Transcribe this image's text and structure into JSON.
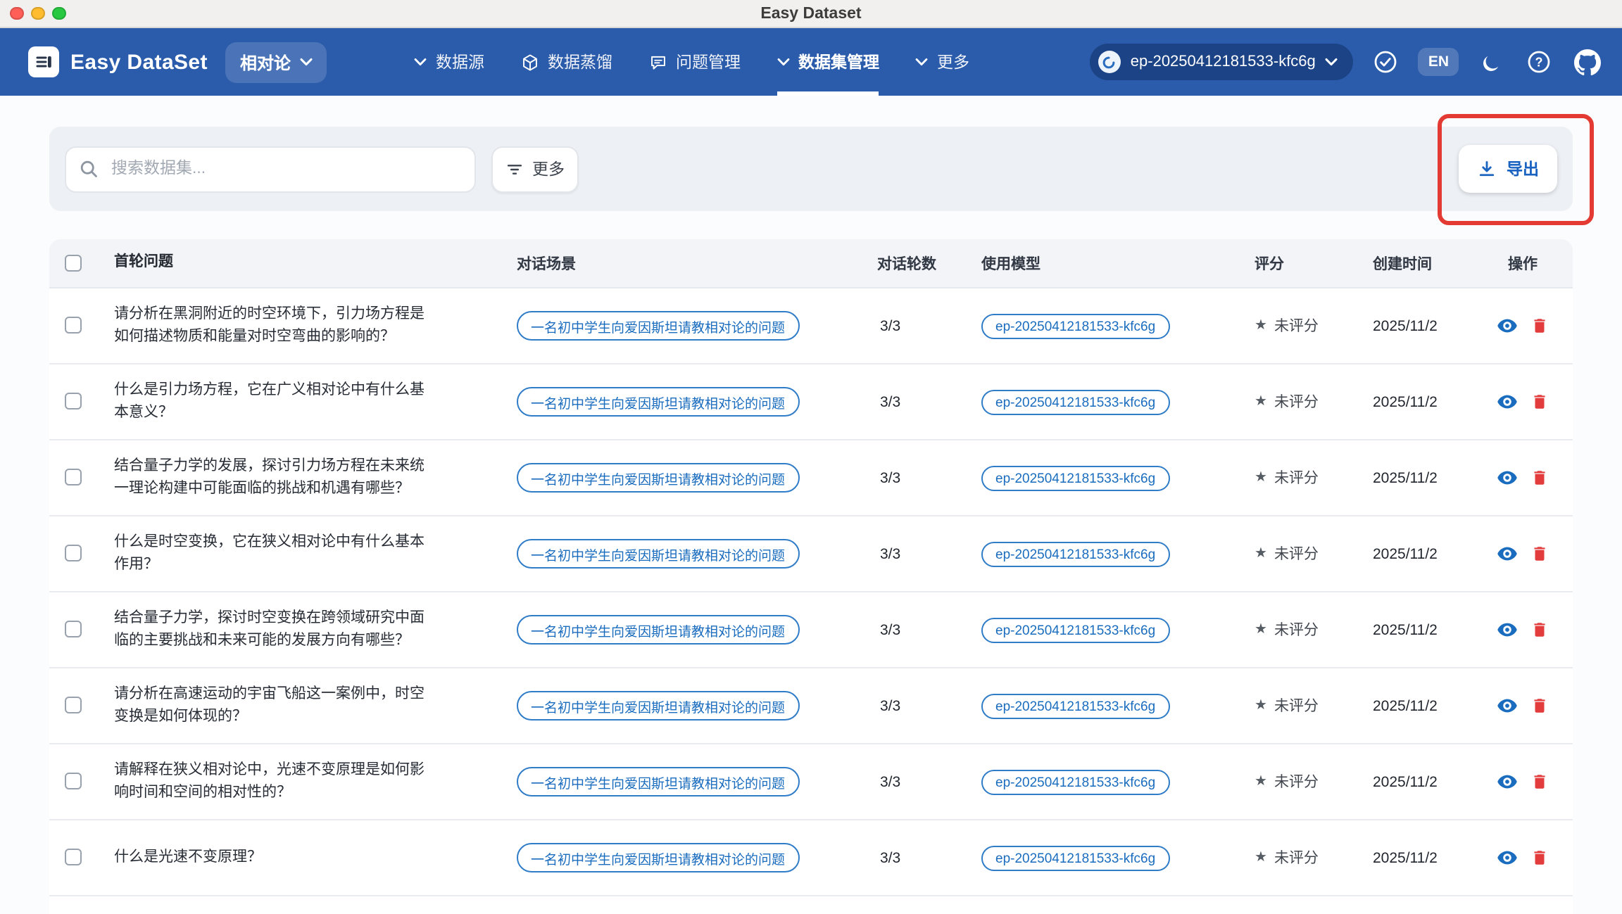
{
  "window": {
    "title": "Easy Dataset"
  },
  "navbar": {
    "brand": "Easy DataSet",
    "project": "相对论",
    "items": [
      {
        "label": "数据源"
      },
      {
        "label": "数据蒸馏"
      },
      {
        "label": "问题管理"
      },
      {
        "label": "数据集管理"
      },
      {
        "label": "更多"
      }
    ],
    "model": "ep-20250412181533-kfc6g",
    "language": "EN"
  },
  "toolbar": {
    "search_placeholder": "搜索数据集...",
    "more_label": "更多",
    "export_label": "导出"
  },
  "table": {
    "star_glyph": "★",
    "headers": [
      "首轮问题",
      "对话场景",
      "对话轮数",
      "使用模型",
      "评分",
      "创建时间",
      "操作"
    ],
    "rows": [
      {
        "question": "请分析在黑洞附近的时空环境下，引力场方程是如何描述物质和能量对时空弯曲的影响的？",
        "scenario": "一名初中学生向爱因斯坦请教相对论的问题",
        "turns": "3/3",
        "model": "ep-20250412181533-kfc6g",
        "rating": "未评分",
        "date": "2025/11/2"
      },
      {
        "question": "什么是引力场方程，它在广义相对论中有什么基本意义？",
        "scenario": "一名初中学生向爱因斯坦请教相对论的问题",
        "turns": "3/3",
        "model": "ep-20250412181533-kfc6g",
        "rating": "未评分",
        "date": "2025/11/2"
      },
      {
        "question": "结合量子力学的发展，探讨引力场方程在未来统一理论构建中可能面临的挑战和机遇有哪些？",
        "scenario": "一名初中学生向爱因斯坦请教相对论的问题",
        "turns": "3/3",
        "model": "ep-20250412181533-kfc6g",
        "rating": "未评分",
        "date": "2025/11/2"
      },
      {
        "question": "什么是时空变换，它在狭义相对论中有什么基本作用？",
        "scenario": "一名初中学生向爱因斯坦请教相对论的问题",
        "turns": "3/3",
        "model": "ep-20250412181533-kfc6g",
        "rating": "未评分",
        "date": "2025/11/2"
      },
      {
        "question": "结合量子力学，探讨时空变换在跨领域研究中面临的主要挑战和未来可能的发展方向有哪些？",
        "scenario": "一名初中学生向爱因斯坦请教相对论的问题",
        "turns": "3/3",
        "model": "ep-20250412181533-kfc6g",
        "rating": "未评分",
        "date": "2025/11/2"
      },
      {
        "question": "请分析在高速运动的宇宙飞船这一案例中，时空变换是如何体现的？",
        "scenario": "一名初中学生向爱因斯坦请教相对论的问题",
        "turns": "3/3",
        "model": "ep-20250412181533-kfc6g",
        "rating": "未评分",
        "date": "2025/11/2"
      },
      {
        "question": "请解释在狭义相对论中，光速不变原理是如何影响时间和空间的相对性的？",
        "scenario": "一名初中学生向爱因斯坦请教相对论的问题",
        "turns": "3/3",
        "model": "ep-20250412181533-kfc6g",
        "rating": "未评分",
        "date": "2025/11/2"
      },
      {
        "question": "什么是光速不变原理？",
        "scenario": "一名初中学生向爱因斯坦请教相对论的问题",
        "turns": "3/3",
        "model": "ep-20250412181533-kfc6g",
        "rating": "未评分",
        "date": "2025/11/2"
      }
    ]
  },
  "colors": {
    "navbar_blue": "#2b5cab",
    "accent_blue": "#1a6cbe",
    "danger_red": "#e23c3c",
    "annotation_red": "#e33b33"
  }
}
